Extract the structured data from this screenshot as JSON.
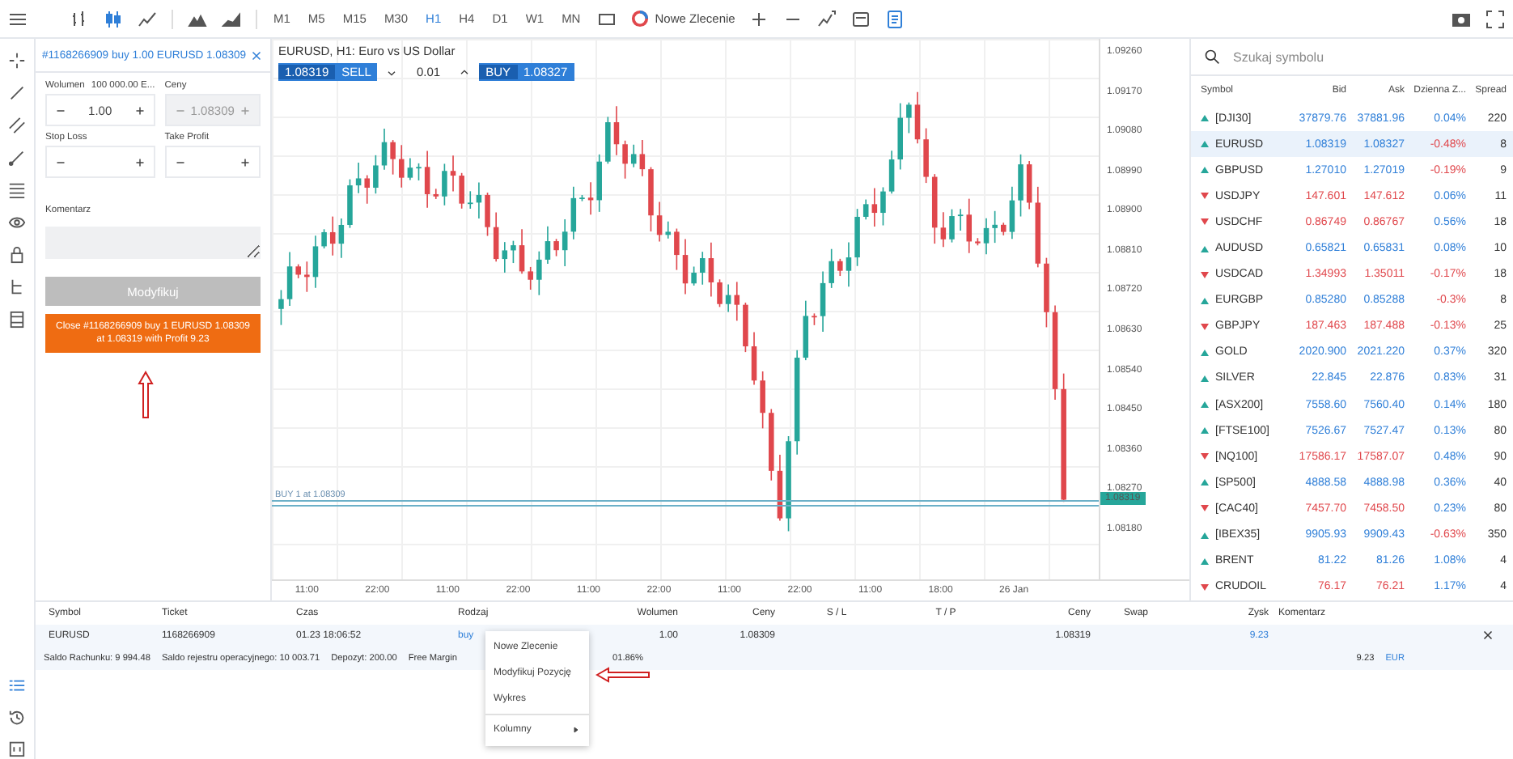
{
  "toolbar": {
    "chart_types": [
      {
        "kind": "bars",
        "selected": false
      },
      {
        "kind": "candles",
        "selected": true
      },
      {
        "kind": "line",
        "selected": false
      }
    ],
    "timeframes": [
      {
        "label": "M1",
        "selected": false
      },
      {
        "label": "M5",
        "selected": false
      },
      {
        "label": "M15",
        "selected": false
      },
      {
        "label": "M30",
        "selected": false
      },
      {
        "label": "H1",
        "selected": true
      },
      {
        "label": "H4",
        "selected": false
      },
      {
        "label": "D1",
        "selected": false
      },
      {
        "label": "W1",
        "selected": false
      },
      {
        "label": "MN",
        "selected": false
      }
    ],
    "new_order": "Nowe Zlecenie"
  },
  "order_panel": {
    "title": "#1168266909 buy 1.00 EURUSD 1.08309",
    "fields": [
      {
        "label": "Wolumen",
        "hint": "100 000.00 E...",
        "value": "1.00",
        "disabled": false
      },
      {
        "label": "Ceny",
        "value": "1.08309",
        "disabled": true
      },
      {
        "label": "Stop Loss",
        "disabled": false
      },
      {
        "label": "Take Profit",
        "disabled": false
      }
    ],
    "comment_label": "Komentarz",
    "modify_button": "Modyfikuj",
    "close_button_lines": [
      "Close #1168266909 buy 1 EURUSD 1.08309",
      "at 1.08319 with Profit 9.23"
    ]
  },
  "chart": {
    "title": "EURUSD, H1: Euro vs US Dollar",
    "sell": {
      "price": "1.08319",
      "label": "SELL"
    },
    "lot": "0.01",
    "buy": {
      "label": "BUY",
      "price": "1.08327"
    },
    "position_line": "BUY 1 at 1.08309",
    "current_price": "1.08319",
    "price_labels": [
      "1.09260",
      "1.09170",
      "1.09080",
      "1.08990",
      "1.08900",
      "1.08810",
      "1.08720",
      "1.08630",
      "1.08540",
      "1.08450",
      "1.08360",
      "1.08270",
      "1.08180"
    ],
    "time_labels": [
      "11:00",
      "22:00",
      "11:00",
      "22:00",
      "11:00",
      "22:00",
      "11:00",
      "22:00",
      "11:00",
      "18:00",
      "26 Jan"
    ]
  },
  "market_watch": {
    "search_placeholder": "Szukaj symbolu",
    "columns": [
      "Symbol",
      "Bid",
      "Ask",
      "Dzienna Z...",
      "Spread"
    ],
    "rows": [
      {
        "symbol": "[DJI30]",
        "bid": "37879.76",
        "ask": "37881.96",
        "change": "0.04%",
        "spread": "220",
        "rising": true,
        "change_falling": false,
        "selected": false
      },
      {
        "symbol": "EURUSD",
        "bid": "1.08319",
        "ask": "1.08327",
        "change": "-0.48%",
        "spread": "8",
        "rising": true,
        "change_falling": true,
        "selected": true
      },
      {
        "symbol": "GBPUSD",
        "bid": "1.27010",
        "ask": "1.27019",
        "change": "-0.19%",
        "spread": "9",
        "rising": true,
        "change_falling": true,
        "selected": false
      },
      {
        "symbol": "USDJPY",
        "bid": "147.601",
        "ask": "147.612",
        "change": "0.06%",
        "spread": "11",
        "rising": false,
        "change_falling": false,
        "selected": false
      },
      {
        "symbol": "USDCHF",
        "bid": "0.86749",
        "ask": "0.86767",
        "change": "0.56%",
        "spread": "18",
        "rising": false,
        "change_falling": false,
        "selected": false
      },
      {
        "symbol": "AUDUSD",
        "bid": "0.65821",
        "ask": "0.65831",
        "change": "0.08%",
        "spread": "10",
        "rising": true,
        "change_falling": false,
        "selected": false
      },
      {
        "symbol": "USDCAD",
        "bid": "1.34993",
        "ask": "1.35011",
        "change": "-0.17%",
        "spread": "18",
        "rising": false,
        "change_falling": true,
        "selected": false
      },
      {
        "symbol": "EURGBP",
        "bid": "0.85280",
        "ask": "0.85288",
        "change": "-0.3%",
        "spread": "8",
        "rising": true,
        "change_falling": true,
        "selected": false
      },
      {
        "symbol": "GBPJPY",
        "bid": "187.463",
        "ask": "187.488",
        "change": "-0.13%",
        "spread": "25",
        "rising": false,
        "change_falling": true,
        "selected": false
      },
      {
        "symbol": "GOLD",
        "bid": "2020.900",
        "ask": "2021.220",
        "change": "0.37%",
        "spread": "320",
        "rising": true,
        "change_falling": false,
        "selected": false
      },
      {
        "symbol": "SILVER",
        "bid": "22.845",
        "ask": "22.876",
        "change": "0.83%",
        "spread": "31",
        "rising": true,
        "change_falling": false,
        "selected": false
      },
      {
        "symbol": "[ASX200]",
        "bid": "7558.60",
        "ask": "7560.40",
        "change": "0.14%",
        "spread": "180",
        "rising": true,
        "change_falling": false,
        "selected": false
      },
      {
        "symbol": "[FTSE100]",
        "bid": "7526.67",
        "ask": "7527.47",
        "change": "0.13%",
        "spread": "80",
        "rising": true,
        "change_falling": false,
        "selected": false
      },
      {
        "symbol": "[NQ100]",
        "bid": "17586.17",
        "ask": "17587.07",
        "change": "0.48%",
        "spread": "90",
        "rising": false,
        "change_falling": false,
        "selected": false
      },
      {
        "symbol": "[SP500]",
        "bid": "4888.58",
        "ask": "4888.98",
        "change": "0.36%",
        "spread": "40",
        "rising": true,
        "change_falling": false,
        "selected": false
      },
      {
        "symbol": "[CAC40]",
        "bid": "7457.70",
        "ask": "7458.50",
        "change": "0.23%",
        "spread": "80",
        "rising": false,
        "change_falling": false,
        "selected": false
      },
      {
        "symbol": "[IBEX35]",
        "bid": "9905.93",
        "ask": "9909.43",
        "change": "-0.63%",
        "spread": "350",
        "rising": true,
        "change_falling": true,
        "selected": false
      },
      {
        "symbol": "BRENT",
        "bid": "81.22",
        "ask": "81.26",
        "change": "1.08%",
        "spread": "4",
        "rising": true,
        "change_falling": false,
        "selected": false
      },
      {
        "symbol": "CRUDOIL",
        "bid": "76.17",
        "ask": "76.21",
        "change": "1.17%",
        "spread": "4",
        "rising": false,
        "change_falling": false,
        "selected": false
      }
    ]
  },
  "positions": {
    "columns": [
      "Symbol",
      "Ticket",
      "Czas",
      "Rodzaj",
      "Wolumen",
      "Ceny",
      "S / L",
      "T / P",
      "Ceny",
      "Swap",
      "Zysk",
      "Komentarz"
    ],
    "row": {
      "symbol": "EURUSD",
      "ticket": "1168266909",
      "time": "01.23 18:06:52",
      "type": "buy",
      "volume": "1.00",
      "open_price": "1.08309",
      "price": "1.08319",
      "profit": "9.23"
    },
    "summary": [
      "Saldo Rachunku: 9 994.48",
      "Saldo rejestru operacyjnego: 10 003.71",
      "Depozyt: 200.00",
      "Free Margin",
      "01.86%"
    ],
    "total_profit": "9.23",
    "currency": "EUR"
  },
  "context_menu": {
    "items": [
      "Nowe Zlecenie",
      "Modyfikuj Pozycję",
      "Wykres"
    ],
    "submenu_item": "Kolumny"
  }
}
